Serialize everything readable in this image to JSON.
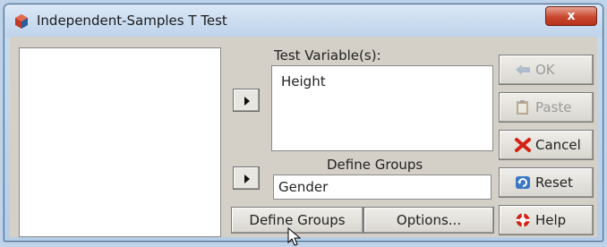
{
  "window": {
    "title": "Independent-Samples T Test",
    "close_label": "x"
  },
  "test_variables": {
    "label": "Test Variable(s):",
    "items": [
      "Height"
    ]
  },
  "grouping": {
    "label": "Define Groups",
    "value": "Gender"
  },
  "bottom_buttons": {
    "define_groups": "Define Groups",
    "options": "Options..."
  },
  "side_buttons": {
    "ok": "OK",
    "paste": "Paste",
    "cancel": "Cancel",
    "reset": "Reset",
    "help": "Help"
  },
  "icons": {
    "app": "spss-app-icon",
    "ok": "ok-arrow-icon",
    "paste": "clipboard-icon",
    "cancel": "red-x-icon",
    "reset": "refresh-icon",
    "help": "lifebuoy-icon"
  },
  "colors": {
    "title_gradient_top": "#dbe8f6",
    "close_button": "#c9472e",
    "dialog_face": "#d4d0c8"
  }
}
